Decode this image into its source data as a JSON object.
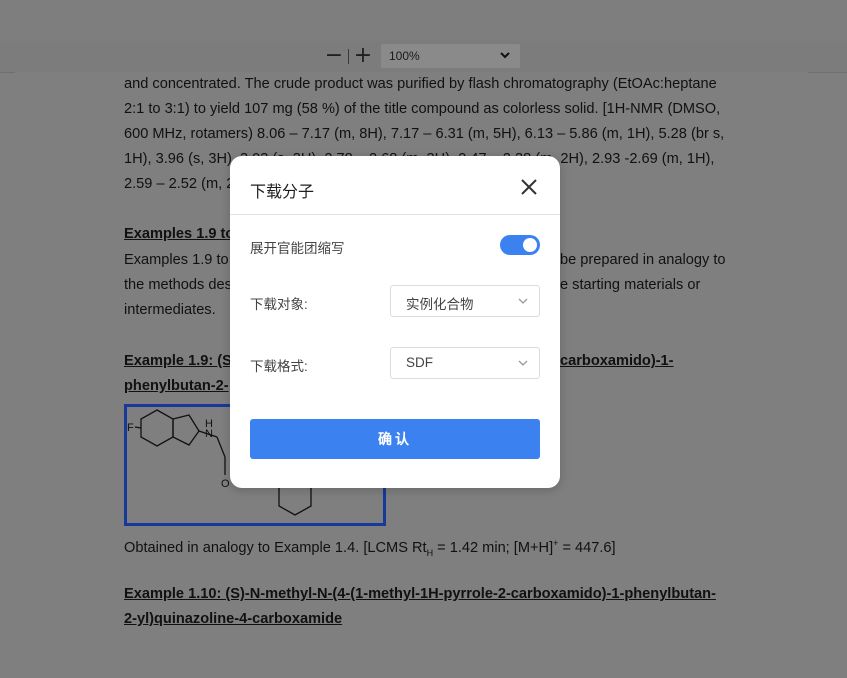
{
  "toolbar": {
    "zoom_out_glyph": "−",
    "zoom_in_glyph": "+",
    "zoom_value": "100%"
  },
  "document": {
    "lines": [
      "and concentrated. The crude product was purified by flash chromatography (EtOAc:heptane",
      "2:1 to 3:1) to yield 107 mg (58 %) of the title compound as colorless solid. [1H-NMR (DMSO,",
      "600 MHz, rotamers) 8.06 – 7.17 (m, 8H), 7.17 – 6.31 (m, 5H), 6.13 – 5.86 (m, 1H), 5.28 (br s,",
      "1H), 3.96 (s, 3H), 3.03 (s, 3H), 2.78 – 2.68 (m, 3H), 2.47 – 2.38 (m, 2H), 2.93 -2.69 (m, 1H),",
      "2.59 – 2.52 (m, 2H); LCMS RtH = 1.44 min; [M+H]⁺ = 471.3]."
    ],
    "heading_a": "Examples 1.9 to",
    "para_a": [
      "Examples 1.9 to 1.10 were prepared in analogy to",
      "the methods described above starting materials or",
      "intermediates."
    ],
    "para_a_right": [
      "be prepared in analogy to",
      "e starting materials or"
    ],
    "heading_b_line1": "Example 1.9: (S)-",
    "heading_b_line1_right": "carboxamido)-1-",
    "heading_b_line2": "phenylbutan-2-",
    "obtained_pre": "Obtained in analogy to Example 1.4. [LCMS Rt",
    "obtained_sub": "H",
    "obtained_mid": " = 1.42 min; [M+H]",
    "obtained_sup": "+",
    "obtained_post": " = 447.6]",
    "heading_c_line1": "Example 1.10: (S)-N-methyl-N-(4-(1-methyl-1H-pyrrole-2-carboxamido)-1-phenylbutan-",
    "heading_c_line2": "2-yl)quinazoline-4-carboxamide",
    "mol_atom_f": "F",
    "mol_atom_nh": "H\nN",
    "mol_atom_o": "O"
  },
  "dialog": {
    "title": "下载分子",
    "toggle_label": "展开官能团缩写",
    "toggle_on": true,
    "target_label": "下载对象:",
    "target_value": "实例化合物",
    "format_label": "下载格式:",
    "format_value": "SDF",
    "confirm_label": "确认"
  },
  "colors": {
    "accent": "#3b82f0",
    "overlay": "#7f7f7f",
    "mol_border": "#17399a"
  }
}
